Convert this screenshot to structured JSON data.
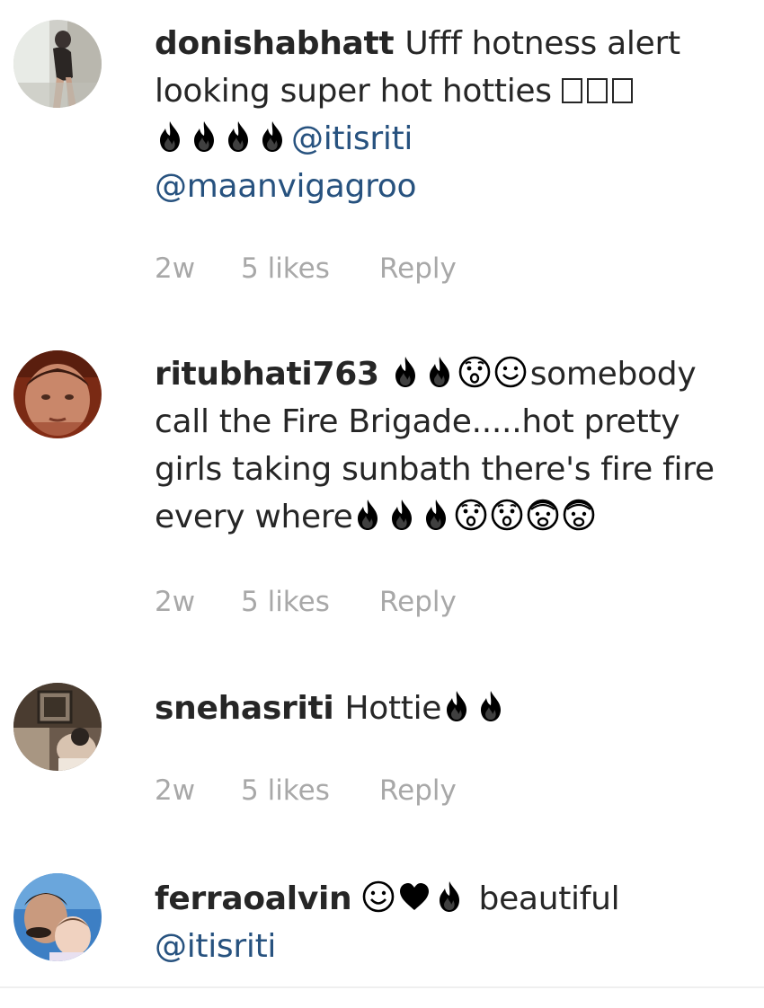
{
  "comments": [
    {
      "username": "donishabhatt",
      "text_a": "Ufff hotness alert looking super hot hotties ",
      "mention1": "@itisriti",
      "mention2": "@maanvigagroo",
      "time": "2w",
      "likes": "5 likes",
      "reply": "Reply"
    },
    {
      "username": "ritubhati763",
      "text_a": "somebody call the Fire Brigade.....hot pretty girls taking sunbath there's fire fire every where",
      "time": "2w",
      "likes": "5 likes",
      "reply": "Reply"
    },
    {
      "username": "snehasriti",
      "text_a": "Hottie",
      "time": "2w",
      "likes": "5 likes",
      "reply": "Reply"
    },
    {
      "username": "ferraoalvin",
      "text_a": " beautiful",
      "mention1": "@itisriti"
    }
  ],
  "colors": {
    "mention": "#27527f",
    "meta": "#a8a8a8",
    "text": "#262626"
  },
  "icons": [
    "fire-emoji",
    "astonished-face-emoji",
    "smiling-face-emoji",
    "fearful-face-emoji",
    "black-heart-emoji"
  ]
}
